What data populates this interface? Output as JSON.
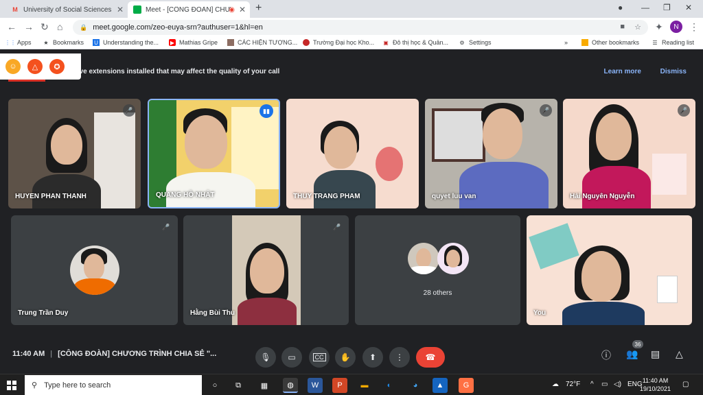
{
  "browser": {
    "tabs": [
      {
        "title": "University of Social Sciences and",
        "favicon": "gmail-icon"
      },
      {
        "title": "Meet - [CÔNG ĐOÀN] CHƯC",
        "favicon": "meet-icon"
      }
    ],
    "url": "meet.google.com/zeo-euya-srn?authuser=1&hl=en",
    "profile_initial": "N"
  },
  "bookmarks": {
    "items": [
      "Apps",
      "Bookmarks",
      "Understanding the...",
      "Mathias Gripe",
      "CÁC HIỆN TƯỢNG...",
      "Trường Đại học Kho...",
      "Đô thị học & Quản...",
      "Settings"
    ],
    "overflow": "»",
    "other": "Other bookmarks",
    "reading": "Reading list"
  },
  "banner": {
    "text": "ave extensions installed that may affect the quality of your call",
    "learn_more": "Learn more",
    "dismiss": "Dismiss"
  },
  "participants": {
    "row1": [
      "HUYEN PHAN THANH",
      "QUANG HỒ NHẬT",
      "THUY TRANG PHAM",
      "quyet luu van",
      "Hải Nguyên Nguyễn"
    ],
    "row2": [
      "Trung Trần Duy",
      "Hằng Bùi Thu",
      "28 others",
      "You"
    ]
  },
  "meeting": {
    "time": "11:40 AM",
    "title": "[CÔNG ĐOÀN] CHƯƠNG TRÌNH CHIA SẺ \"...",
    "people_count": "36"
  },
  "taskbar": {
    "search_placeholder": "Type here to search",
    "temperature": "72°F",
    "language": "ENG",
    "time": "11:40 AM",
    "date": "19/10/2021"
  },
  "colors": {
    "meet_bg": "#202124",
    "end_call": "#ea4335",
    "active_speaker": "#1a73e8",
    "link": "#8ab4f8"
  }
}
